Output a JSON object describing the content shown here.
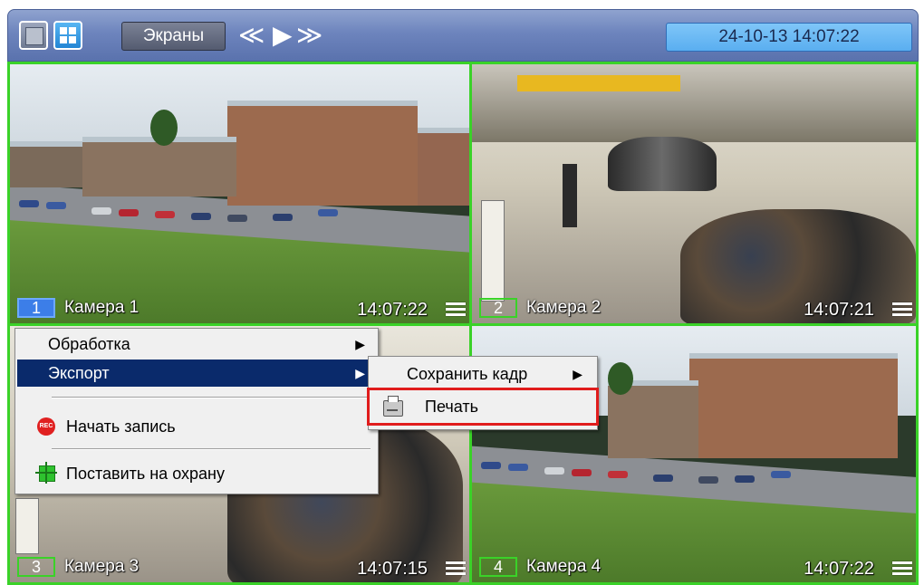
{
  "toolbar": {
    "screens_label": "Экраны",
    "nav_prev": "≪",
    "nav_play": "▶",
    "nav_next": "≫",
    "datetime": "24-10-13  14:07:22",
    "accent_color": "#6d84bd"
  },
  "cameras": [
    {
      "num": "1",
      "name": "Камера 1",
      "time": "14:07:22",
      "active": true
    },
    {
      "num": "2",
      "name": "Камера 2",
      "time": "14:07:21",
      "active": false
    },
    {
      "num": "3",
      "name": "Камера 3",
      "time": "14:07:15",
      "active": false
    },
    {
      "num": "4",
      "name": "Камера 4",
      "time": "14:07:22",
      "active": false
    }
  ],
  "context_menu": {
    "items": [
      {
        "label": "Обработка",
        "has_submenu": true
      },
      {
        "label": "Экспорт",
        "has_submenu": true,
        "highlighted": true
      },
      {
        "label": "Начать запись",
        "icon": "record-icon",
        "icon_text": "REC"
      },
      {
        "label": "Поставить на охрану",
        "icon": "arm-icon"
      }
    ]
  },
  "submenu": {
    "items": [
      {
        "label": "Сохранить кадр",
        "has_submenu": true
      },
      {
        "label": "Печать",
        "icon": "printer-icon",
        "emphasized": true
      }
    ],
    "emphasis_color": "#e01c1c"
  }
}
